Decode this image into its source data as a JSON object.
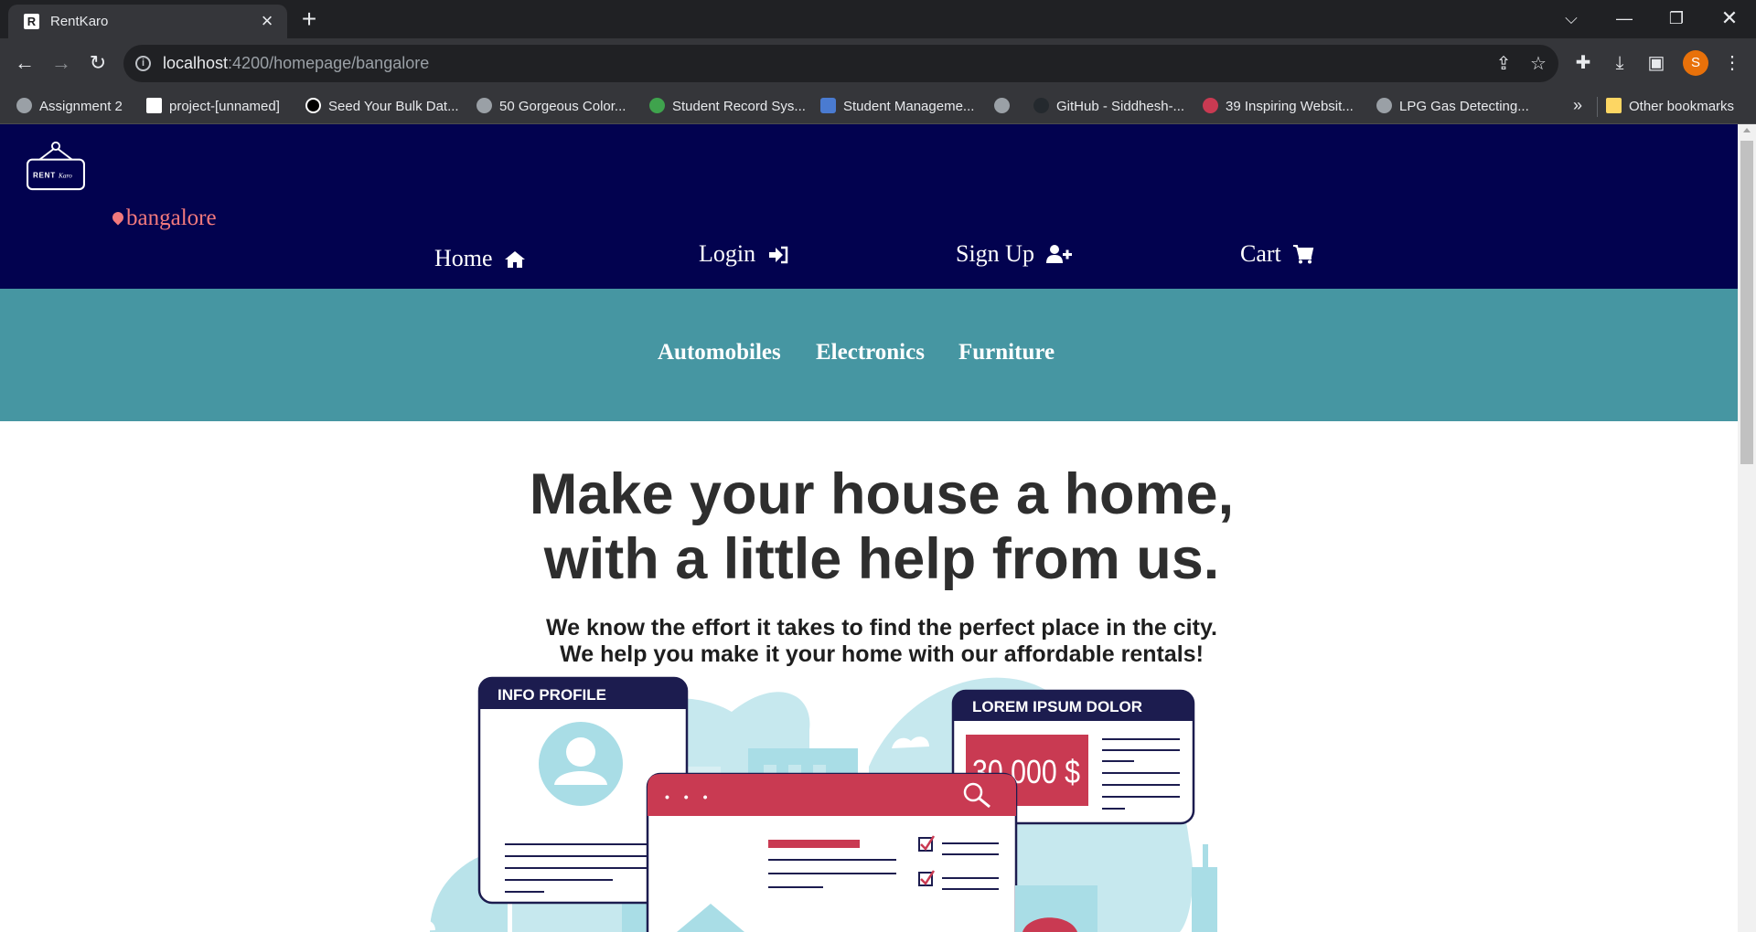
{
  "browser": {
    "tab_title": "RentKaro",
    "tab_favicon_letter": "R",
    "url_host": "localhost",
    "url_path": ":4200/homepage/bangalore",
    "avatar_letter": "S",
    "bookmarks": [
      {
        "label": "Assignment 2",
        "icon": "globe-icon"
      },
      {
        "label": "project-[unnamed]",
        "icon": "notion-icon"
      },
      {
        "label": "Seed Your Bulk Dat...",
        "icon": "medium-icon"
      },
      {
        "label": "50 Gorgeous Color...",
        "icon": "site-icon"
      },
      {
        "label": "Student Record Sys...",
        "icon": "site-icon"
      },
      {
        "label": "Student Manageme...",
        "icon": "site-icon"
      },
      {
        "label": "",
        "icon": "globe-icon"
      },
      {
        "label": "GitHub - Siddhesh-...",
        "icon": "github-icon"
      },
      {
        "label": "39 Inspiring Websit...",
        "icon": "site-icon"
      },
      {
        "label": "LPG Gas Detecting...",
        "icon": "globe-icon"
      }
    ],
    "bookmarks_more": "»",
    "other_bookmarks": "Other bookmarks"
  },
  "site": {
    "logo_text": "RENT",
    "logo_script": "Karo",
    "location": "bangalore",
    "nav": {
      "home": "Home",
      "login": "Login",
      "signup": "Sign Up",
      "cart": "Cart"
    },
    "categories": [
      "Automobiles",
      "Electronics",
      "Furniture"
    ],
    "hero": {
      "title_line1": "Make your house a home,",
      "title_line2": "with a little help from us.",
      "sub_line1": "We know the effort it takes to find the perfect place in the city.",
      "sub_line2": "We help you make it your home with our affordable rentals!"
    },
    "illustration": {
      "card1_title": "INFO PROFILE",
      "card2_title": "LOREM IPSUM DOLOR",
      "price": "30,000 $",
      "dots": "• • •"
    }
  },
  "colors": {
    "header_bg": "#02024f",
    "category_bar_bg": "#4696a2",
    "location_accent": "#f2797d",
    "illustration_red": "#c93a52",
    "illustration_navy": "#1c1c4f",
    "illustration_light_blue": "#a9dde6"
  }
}
